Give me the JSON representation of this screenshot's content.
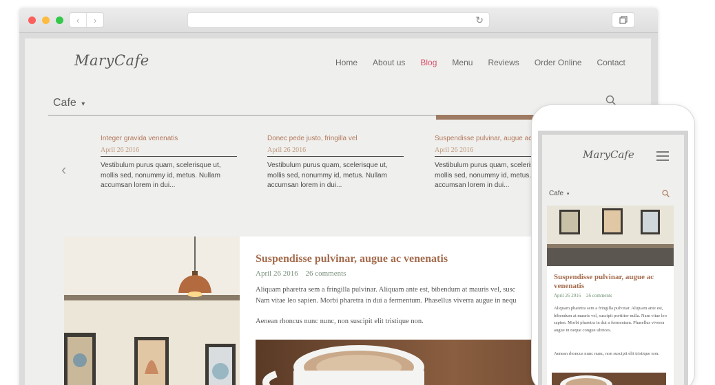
{
  "site": {
    "logo": "MaryCafe",
    "nav": [
      "Home",
      "About us",
      "Blog",
      "Menu",
      "Reviews",
      "Order Online",
      "Contact"
    ],
    "active_nav": "Blog",
    "category": "Cafe",
    "caret": "▾"
  },
  "carousel": {
    "prev_icon": "‹",
    "slides": [
      {
        "title": "Integer gravida venenatis",
        "date": "April 26 2016",
        "excerpt": "Vestibulum purus quam, scelerisque ut, mollis sed, nonummy id, metus. Nullam accumsan lorem in dui..."
      },
      {
        "title": "Donec pede justo, fringilla vel",
        "date": "April 26 2016",
        "excerpt": "Vestibulum purus quam, scelerisque ut, mollis sed, nonummy id, metus. Nullam accumsan lorem in dui..."
      },
      {
        "title": "Suspendisse pulvinar, augue ac",
        "date": "April 26 2016",
        "excerpt": "Vestibulum purus quam, scelerisque ut, mollis sed, nonummy id, metus. Nullam accumsan lorem in dui..."
      }
    ]
  },
  "featured": {
    "title": "Suspendisse pulvinar, augue ac venenatis",
    "date": "April 26 2016",
    "comments": "26 comments",
    "body_line1": "Aliquam pharetra sem a fringilla pulvinar. Aliquam ante est, bibendum at mauris vel, susc",
    "body_line2": "Nam vitae leo sapien. Morbi pharetra in dui a fermentum. Phasellus viverra augue in nequ",
    "body2": "Aenean rhoncus nunc nunc, non suscipit elit tristique non."
  },
  "mobile": {
    "logo": "MaryCafe",
    "category": "Cafe",
    "caret": "▾",
    "title": "Suspendisse pulvinar, augue ac venenatis",
    "date": "April 26 2016",
    "comments": "26 comments",
    "body": "Aliquam pharetra sem a fringilla pulvinar. Aliquam ante est, bibendum at mauris vel, suscipit porttitor nulla. Nam vitae leo sapien. Morbi pharetra in dui a fermentum. Phasellus viverra augue in neque congue ultrices.",
    "body2": "Aenean rhoncus nunc nunc, non suscipit elit tristique non."
  },
  "browser": {
    "back_icon": "‹",
    "forward_icon": "›",
    "reload_icon": "↻"
  },
  "colors": {
    "accent": "#d9506a",
    "post_title": "#a56c4e",
    "category_bar": "#9e7a63"
  }
}
